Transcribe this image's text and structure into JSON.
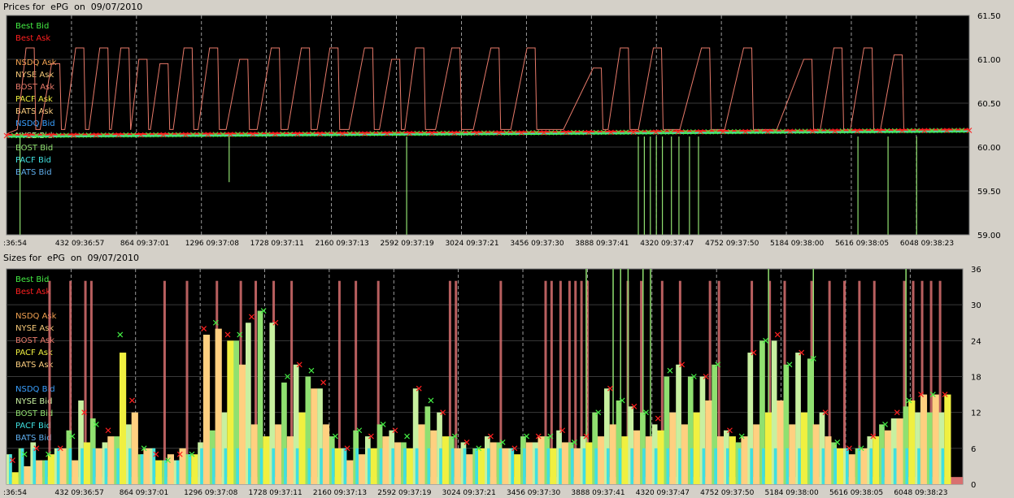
{
  "window": {
    "price_title": "Prices for  ePG  on  09/07/2010",
    "size_title": "Sizes for  ePG  on  09/07/2010"
  },
  "chart_data": [
    {
      "type": "line",
      "title": "Prices for  ePG  on  09/07/2010",
      "ylim": [
        59.0,
        61.5
      ],
      "y_ticks": [
        "61.50",
        "61.00",
        "60.50",
        "60.00",
        "59.50",
        "59.00"
      ],
      "x_ticks": [
        ":36:54",
        "432 09:36:57",
        "864 09:37:01",
        "1296 09:37:08",
        "1728 09:37:11",
        "2160 09:37:13",
        "2592 09:37:19",
        "3024 09:37:21",
        "3456 09:37:30",
        "3888 09:37:41",
        "4320 09:37:47",
        "4752 09:37:50",
        "5184 09:38:00",
        "5616 09:38:05",
        "6048 09:38:23"
      ],
      "xlim": [
        0,
        6400
      ],
      "grid": true,
      "legend_position": "top-left",
      "legend": [
        {
          "label": "Best Bid",
          "color": "#44ee44"
        },
        {
          "label": "Best Ask",
          "color": "#ff2020"
        },
        {
          "label": "",
          "color": ""
        },
        {
          "label": "NSDQ Ask",
          "color": "#f0a050"
        },
        {
          "label": "NYSE Ask",
          "color": "#f5c878"
        },
        {
          "label": "BOST Ask",
          "color": "#e87a6a"
        },
        {
          "label": "PACF Ask",
          "color": "#f0f040"
        },
        {
          "label": "BATS Ask",
          "color": "#ffd080"
        },
        {
          "label": "NSDQ Bid",
          "color": "#3aa0ff"
        },
        {
          "label": "NYSE Bid",
          "color": "#c8f0a0"
        },
        {
          "label": "BOST Bid",
          "color": "#90e070"
        },
        {
          "label": "PACF Bid",
          "color": "#40e0e0"
        },
        {
          "label": "BATS Bid",
          "color": "#60b0f0"
        }
      ],
      "series": [
        {
          "name": "Best Bid",
          "values": [
            60.12,
            60.13,
            60.14,
            60.15,
            60.16,
            60.17,
            60.18
          ]
        },
        {
          "name": "Best Ask",
          "values": [
            60.14,
            60.15,
            60.16,
            60.17,
            60.18,
            60.19,
            60.2
          ]
        },
        {
          "name": "BOST Ask",
          "values": [
            61.13,
            61.13,
            61.13,
            61.13,
            61.13,
            61.13,
            61.13
          ]
        },
        {
          "name": "BOST Bid",
          "values": [
            59.0,
            59.0,
            59.0,
            59.0,
            59.0,
            59.0,
            59.0
          ]
        }
      ],
      "ask_peaks": [
        {
          "x": 0,
          "y": 60.15
        },
        {
          "x": 130,
          "y": 61.13
        },
        {
          "x": 300,
          "y": 60.95
        },
        {
          "x": 460,
          "y": 61.13
        },
        {
          "x": 620,
          "y": 61.13
        },
        {
          "x": 760,
          "y": 61.13
        },
        {
          "x": 880,
          "y": 61.0
        },
        {
          "x": 1020,
          "y": 60.95
        },
        {
          "x": 1180,
          "y": 61.13
        },
        {
          "x": 1350,
          "y": 61.13
        },
        {
          "x": 1550,
          "y": 61.0
        },
        {
          "x": 1760,
          "y": 61.13
        },
        {
          "x": 1960,
          "y": 61.13
        },
        {
          "x": 2150,
          "y": 61.13
        },
        {
          "x": 2380,
          "y": 61.13
        },
        {
          "x": 2560,
          "y": 61.0
        },
        {
          "x": 2720,
          "y": 61.13
        },
        {
          "x": 2960,
          "y": 61.13
        },
        {
          "x": 3220,
          "y": 61.13
        },
        {
          "x": 3460,
          "y": 61.13
        },
        {
          "x": 3900,
          "y": 60.9
        },
        {
          "x": 4080,
          "y": 61.13
        },
        {
          "x": 4300,
          "y": 61.13
        },
        {
          "x": 4620,
          "y": 61.13
        },
        {
          "x": 4900,
          "y": 61.13
        },
        {
          "x": 5300,
          "y": 61.0
        },
        {
          "x": 5500,
          "y": 61.13
        },
        {
          "x": 5700,
          "y": 61.13
        },
        {
          "x": 5900,
          "y": 61.05
        }
      ],
      "bid_drops": [
        {
          "x": 90,
          "y": 59.0
        },
        {
          "x": 1480,
          "y": 59.6
        },
        {
          "x": 2660,
          "y": 59.0
        },
        {
          "x": 4200,
          "y": 59.0
        },
        {
          "x": 4240,
          "y": 59.0
        },
        {
          "x": 4280,
          "y": 59.0
        },
        {
          "x": 4320,
          "y": 59.0
        },
        {
          "x": 4360,
          "y": 59.0
        },
        {
          "x": 4420,
          "y": 59.0
        },
        {
          "x": 4470,
          "y": 59.0
        },
        {
          "x": 4540,
          "y": 59.0
        },
        {
          "x": 4600,
          "y": 59.0
        },
        {
          "x": 5660,
          "y": 59.0
        },
        {
          "x": 5860,
          "y": 59.0
        },
        {
          "x": 6050,
          "y": 59.0
        }
      ]
    },
    {
      "type": "bar",
      "title": "Sizes for  ePG  on  09/07/2010",
      "ylim": [
        0,
        36
      ],
      "y_ticks": [
        "36",
        "30",
        "24",
        "18",
        "12",
        "6",
        "0"
      ],
      "x_ticks": [
        ":36:54",
        "432 09:36:57",
        "864 09:37:01",
        "1296 09:37:08",
        "1728 09:37:11",
        "2160 09:37:13",
        "2592 09:37:19",
        "3024 09:37:21",
        "3456 09:37:30",
        "3888 09:37:41",
        "4320 09:37:47",
        "4752 09:37:50",
        "5184 09:38:00",
        "5616 09:38:05",
        "6048 09:38:23"
      ],
      "xlim": [
        0,
        6400
      ],
      "grid": true,
      "legend_position": "top-left",
      "legend": [
        {
          "label": "Best Bid",
          "color": "#44ee44"
        },
        {
          "label": "Best Ask",
          "color": "#ff2020"
        },
        {
          "label": "",
          "color": ""
        },
        {
          "label": "NSDQ Ask",
          "color": "#f0a050"
        },
        {
          "label": "NYSE Ask",
          "color": "#f5c878"
        },
        {
          "label": "BOST Ask",
          "color": "#e87a6a"
        },
        {
          "label": "PACF Ask",
          "color": "#f0f040"
        },
        {
          "label": "BATS Ask",
          "color": "#ffd080"
        },
        {
          "label": "",
          "color": ""
        },
        {
          "label": "NSDQ Bid",
          "color": "#3aa0ff"
        },
        {
          "label": "NYSE Bid",
          "color": "#c8f0a0"
        },
        {
          "label": "BOST Bid",
          "color": "#90e070"
        },
        {
          "label": "PACF Bid",
          "color": "#40e0e0"
        },
        {
          "label": "BATS Bid",
          "color": "#60b0f0"
        }
      ],
      "bost_ask_spikes": [
        280,
        420,
        520,
        560,
        1050,
        1200,
        1400,
        1560,
        1660,
        1780,
        1900,
        2220,
        2330,
        2480,
        2960,
        3000,
        3300,
        3600,
        3640,
        3700,
        3760,
        3800,
        3840,
        3880,
        4150,
        4240,
        4380,
        4500,
        4700,
        4760,
        4980,
        5100,
        5200,
        5380,
        5500,
        5600,
        5700,
        5800,
        6000,
        6060,
        6120,
        6180,
        6240
      ],
      "bid_spikes": [
        3880,
        4060,
        4110,
        4160,
        4260,
        4310,
        5100,
        5400,
        6020
      ],
      "samples": [
        {
          "x": 0,
          "ask": 2,
          "bid": 5,
          "best": 4
        },
        {
          "x": 80,
          "ask": 3,
          "bid": 6,
          "best": 5
        },
        {
          "x": 160,
          "ask": 4,
          "bid": 7,
          "best": 6
        },
        {
          "x": 240,
          "ask": 5,
          "bid": 4,
          "best": 5
        },
        {
          "x": 320,
          "ask": 6,
          "bid": 6,
          "best": 6
        },
        {
          "x": 400,
          "ask": 4,
          "bid": 9,
          "best": 8
        },
        {
          "x": 480,
          "ask": 7,
          "bid": 14,
          "best": 12
        },
        {
          "x": 560,
          "ask": 6,
          "bid": 11,
          "best": 10
        },
        {
          "x": 640,
          "ask": 8,
          "bid": 7,
          "best": 9
        },
        {
          "x": 720,
          "ask": 22,
          "bid": 8,
          "best": 25
        },
        {
          "x": 800,
          "ask": 12,
          "bid": 10,
          "best": 14
        },
        {
          "x": 880,
          "ask": 6,
          "bid": 5,
          "best": 6
        },
        {
          "x": 960,
          "ask": 4,
          "bid": 6,
          "best": 5
        },
        {
          "x": 1040,
          "ask": 5,
          "bid": 4,
          "best": 4
        },
        {
          "x": 1120,
          "ask": 6,
          "bid": 4,
          "best": 5
        },
        {
          "x": 1200,
          "ask": 5,
          "bid": 5,
          "best": 5
        },
        {
          "x": 1280,
          "ask": 25,
          "bid": 7,
          "best": 26
        },
        {
          "x": 1360,
          "ask": 26,
          "bid": 9,
          "best": 27
        },
        {
          "x": 1440,
          "ask": 24,
          "bid": 12,
          "best": 25
        },
        {
          "x": 1520,
          "ask": 20,
          "bid": 24,
          "best": 25
        },
        {
          "x": 1600,
          "ask": 10,
          "bid": 27,
          "best": 28
        },
        {
          "x": 1680,
          "ask": 8,
          "bid": 29,
          "best": 29
        },
        {
          "x": 1760,
          "ask": 10,
          "bid": 27,
          "best": 27
        },
        {
          "x": 1840,
          "ask": 8,
          "bid": 17,
          "best": 18
        },
        {
          "x": 1920,
          "ask": 12,
          "bid": 20,
          "best": 20
        },
        {
          "x": 2000,
          "ask": 16,
          "bid": 18,
          "best": 19
        },
        {
          "x": 2080,
          "ask": 10,
          "bid": 16,
          "best": 17
        },
        {
          "x": 2160,
          "ask": 6,
          "bid": 8,
          "best": 8
        },
        {
          "x": 2240,
          "ask": 4,
          "bid": 6,
          "best": 6
        },
        {
          "x": 2320,
          "ask": 5,
          "bid": 9,
          "best": 9
        },
        {
          "x": 2400,
          "ask": 6,
          "bid": 8,
          "best": 8
        },
        {
          "x": 2480,
          "ask": 8,
          "bid": 10,
          "best": 10
        },
        {
          "x": 2560,
          "ask": 7,
          "bid": 9,
          "best": 9
        },
        {
          "x": 2640,
          "ask": 6,
          "bid": 7,
          "best": 8
        },
        {
          "x": 2720,
          "ask": 10,
          "bid": 16,
          "best": 16
        },
        {
          "x": 2800,
          "ask": 9,
          "bid": 13,
          "best": 14
        },
        {
          "x": 2880,
          "ask": 8,
          "bid": 12,
          "best": 12
        },
        {
          "x": 2960,
          "ask": 6,
          "bid": 8,
          "best": 8
        },
        {
          "x": 3040,
          "ask": 5,
          "bid": 7,
          "best": 7
        },
        {
          "x": 3120,
          "ask": 6,
          "bid": 6,
          "best": 6
        },
        {
          "x": 3200,
          "ask": 7,
          "bid": 8,
          "best": 8
        },
        {
          "x": 3280,
          "ask": 6,
          "bid": 7,
          "best": 7
        },
        {
          "x": 3360,
          "ask": 5,
          "bid": 6,
          "best": 6
        },
        {
          "x": 3440,
          "ask": 7,
          "bid": 8,
          "best": 8
        },
        {
          "x": 3520,
          "ask": 8,
          "bid": 7,
          "best": 8
        },
        {
          "x": 3600,
          "ask": 6,
          "bid": 8,
          "best": 8
        },
        {
          "x": 3680,
          "ask": 7,
          "bid": 9,
          "best": 9
        },
        {
          "x": 3760,
          "ask": 6,
          "bid": 7,
          "best": 7
        },
        {
          "x": 3840,
          "ask": 7,
          "bid": 8,
          "best": 8
        },
        {
          "x": 3920,
          "ask": 8,
          "bid": 12,
          "best": 12
        },
        {
          "x": 4000,
          "ask": 10,
          "bid": 16,
          "best": 16
        },
        {
          "x": 4080,
          "ask": 8,
          "bid": 14,
          "best": 14
        },
        {
          "x": 4160,
          "ask": 9,
          "bid": 13,
          "best": 13
        },
        {
          "x": 4240,
          "ask": 8,
          "bid": 12,
          "best": 12
        },
        {
          "x": 4320,
          "ask": 9,
          "bid": 10,
          "best": 11
        },
        {
          "x": 4400,
          "ask": 12,
          "bid": 18,
          "best": 19
        },
        {
          "x": 4480,
          "ask": 10,
          "bid": 20,
          "best": 20
        },
        {
          "x": 4560,
          "ask": 12,
          "bid": 18,
          "best": 18
        },
        {
          "x": 4640,
          "ask": 14,
          "bid": 18,
          "best": 18
        },
        {
          "x": 4720,
          "ask": 8,
          "bid": 20,
          "best": 20
        },
        {
          "x": 4800,
          "ask": 8,
          "bid": 9,
          "best": 9
        },
        {
          "x": 4880,
          "ask": 8,
          "bid": 7,
          "best": 8
        },
        {
          "x": 4960,
          "ask": 10,
          "bid": 22,
          "best": 22
        },
        {
          "x": 5040,
          "ask": 12,
          "bid": 24,
          "best": 24
        },
        {
          "x": 5120,
          "ask": 14,
          "bid": 24,
          "best": 25
        },
        {
          "x": 5200,
          "ask": 10,
          "bid": 20,
          "best": 20
        },
        {
          "x": 5280,
          "ask": 12,
          "bid": 22,
          "best": 22
        },
        {
          "x": 5360,
          "ask": 10,
          "bid": 21,
          "best": 21
        },
        {
          "x": 5440,
          "ask": 8,
          "bid": 12,
          "best": 12
        },
        {
          "x": 5520,
          "ask": 6,
          "bid": 7,
          "best": 7
        },
        {
          "x": 5600,
          "ask": 5,
          "bid": 6,
          "best": 6
        },
        {
          "x": 5680,
          "ask": 6,
          "bid": 6,
          "best": 6
        },
        {
          "x": 5760,
          "ask": 8,
          "bid": 8,
          "best": 8
        },
        {
          "x": 5840,
          "ask": 9,
          "bid": 10,
          "best": 10
        },
        {
          "x": 5920,
          "ask": 11,
          "bid": 11,
          "best": 12
        },
        {
          "x": 6000,
          "ask": 14,
          "bid": 13,
          "best": 14
        },
        {
          "x": 6080,
          "ask": 15,
          "bid": 12,
          "best": 15
        },
        {
          "x": 6160,
          "ask": 15,
          "bid": 12,
          "best": 15
        },
        {
          "x": 6240,
          "ask": 15,
          "bid": 12,
          "best": 15
        }
      ]
    }
  ]
}
